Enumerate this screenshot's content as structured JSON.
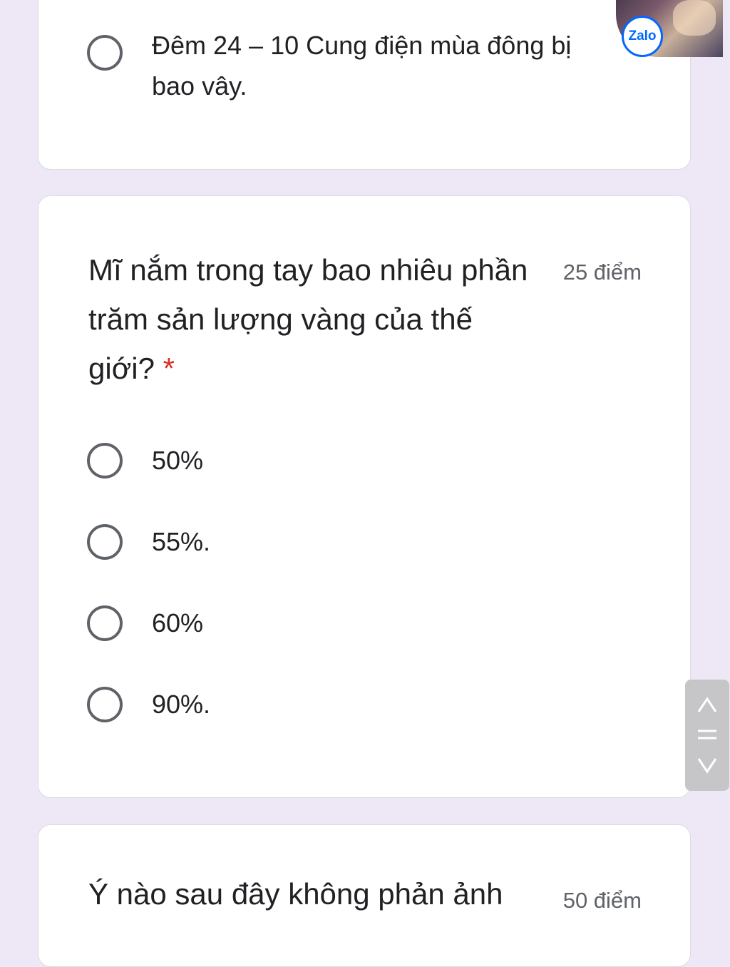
{
  "previous_question": {
    "option_text": "Đêm 24 – 10 Cung điện mùa đông bị bao vây."
  },
  "question": {
    "title": "Mĩ nắm trong tay bao nhiêu phần trăm sản lượng vàng của thế giới?",
    "required_mark": "*",
    "points": "25 điểm",
    "options": [
      {
        "label": "50%",
        "selected": false
      },
      {
        "label": "55%.",
        "selected": false
      },
      {
        "label": "60%",
        "selected": false
      },
      {
        "label": "90%.",
        "selected": false
      }
    ]
  },
  "next_question": {
    "title": "Ý nào sau đây không phản ảnh",
    "points": "50 điểm"
  },
  "overlay": {
    "zalo_label": "Zalo"
  },
  "colors": {
    "page_background": "#ede7f6",
    "card_background": "#ffffff",
    "required": "#d93025",
    "radio_border": "#5f6368",
    "zalo_blue": "#0068ff"
  },
  "icons": {
    "radio": "radio-unchecked-icon",
    "scroll_up": "chevron-up-icon",
    "scroll_menu": "drag-handle-icon",
    "scroll_down": "chevron-down-icon",
    "zalo": "zalo-logo-icon"
  }
}
